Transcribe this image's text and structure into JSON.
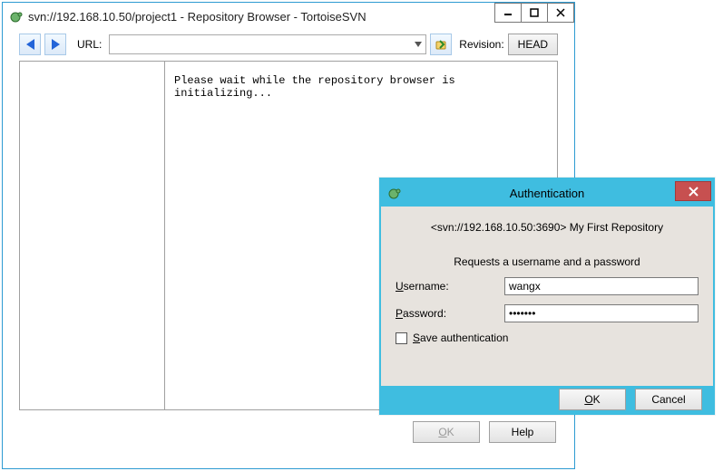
{
  "main": {
    "title": "svn://192.168.10.50/project1 - Repository Browser - TortoiseSVN",
    "toolbar": {
      "url_label": "URL:",
      "url_value": "",
      "revision_label": "Revision:",
      "head_label": "HEAD"
    },
    "status_text": "Please wait while the repository browser is initializing...",
    "buttons": {
      "ok": "OK",
      "help": "Help"
    }
  },
  "auth": {
    "title": "Authentication",
    "repo_line": "<svn://192.168.10.50:3690> My First Repository",
    "requests_line": "Requests a username and a password",
    "username_label": "Username:",
    "password_label": "Password:",
    "username_value": "wangx",
    "password_value": "•••••••",
    "save_label": "Save authentication",
    "ok": "OK",
    "cancel": "Cancel"
  },
  "icons": {
    "tortoise": "tortoise-icon",
    "back": "back-arrow-icon",
    "forward": "forward-arrow-icon",
    "go": "go-icon",
    "minimize": "minimize-icon",
    "maximize": "maximize-icon",
    "close": "close-icon"
  }
}
